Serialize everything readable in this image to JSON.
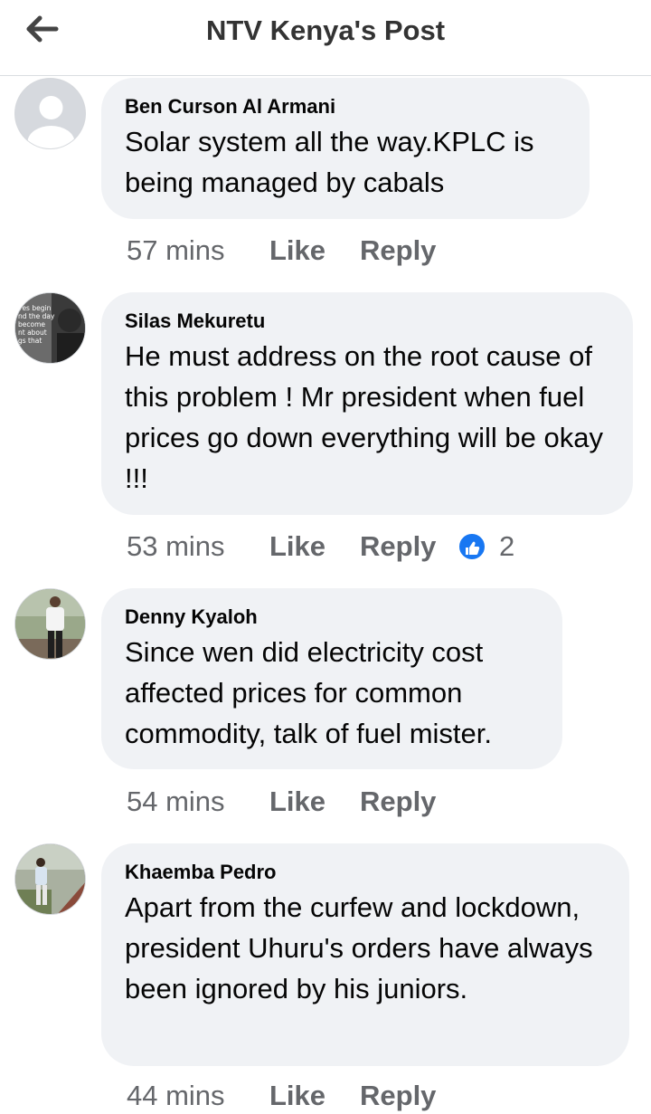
{
  "header": {
    "title": "NTV Kenya's Post"
  },
  "comments": [
    {
      "author": "Ben Curson Al Armani",
      "text": "Solar system all the way.KPLC is being managed by cabals",
      "time": "57 mins",
      "like": "Like",
      "reply": "Reply"
    },
    {
      "author": "Silas Mekuretu",
      "text": "He must address on the root cause of this problem ! Mr president when fuel prices go down everything will be okay !!!",
      "time": "53 mins",
      "like": "Like",
      "reply": "Reply",
      "reaction_count": "2",
      "avatar_text": [
        "ves begin",
        "nd the day",
        "become",
        "nt about",
        "gs that"
      ]
    },
    {
      "author": "Denny Kyaloh",
      "text": "Since wen did electricity cost affected prices for common commodity, talk of fuel mister.",
      "time": "54 mins",
      "like": "Like",
      "reply": "Reply"
    },
    {
      "author": "Khaemba Pedro",
      "text": "Apart from the curfew and lockdown, president Uhuru's orders have always been ignored by his juniors.",
      "time": "44 mins",
      "like": "Like",
      "reply": "Reply"
    }
  ],
  "colors": {
    "bubble": "#f0f2f5",
    "meta": "#65676b",
    "like_blue": "#1877f2"
  },
  "icons": [
    "back-arrow-icon",
    "default-avatar-icon",
    "like-reaction-icon"
  ]
}
